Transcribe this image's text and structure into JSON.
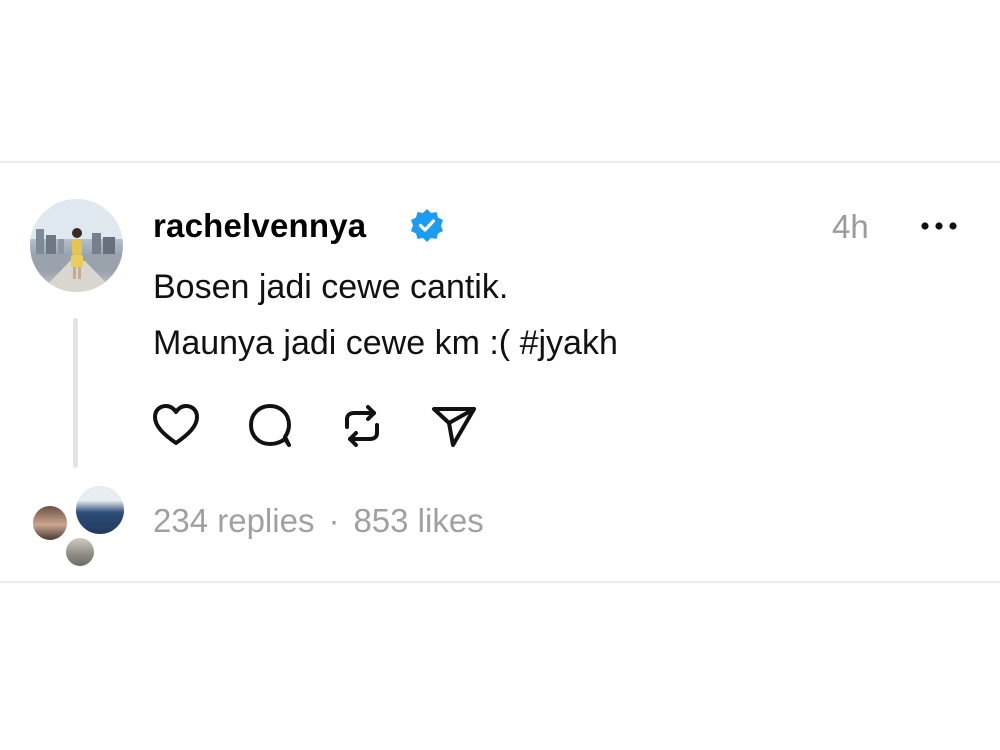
{
  "post": {
    "username": "rachelvennya",
    "timestamp": "4h",
    "text_line1": "Bosen jadi cewe cantik.",
    "text_line2": "Maunya jadi cewe km :( #jyakh",
    "replies": "234 replies",
    "separator": "·",
    "likes": "853 likes"
  },
  "icons": {
    "verified": "verified-badge-icon",
    "more": "more-options-icon",
    "like": "heart-icon",
    "reply": "comment-icon",
    "repost": "repost-icon",
    "share": "send-icon"
  },
  "colors": {
    "verified": "#1d9bf0",
    "muted_text": "#9a9a9a",
    "divider": "#ececec"
  }
}
